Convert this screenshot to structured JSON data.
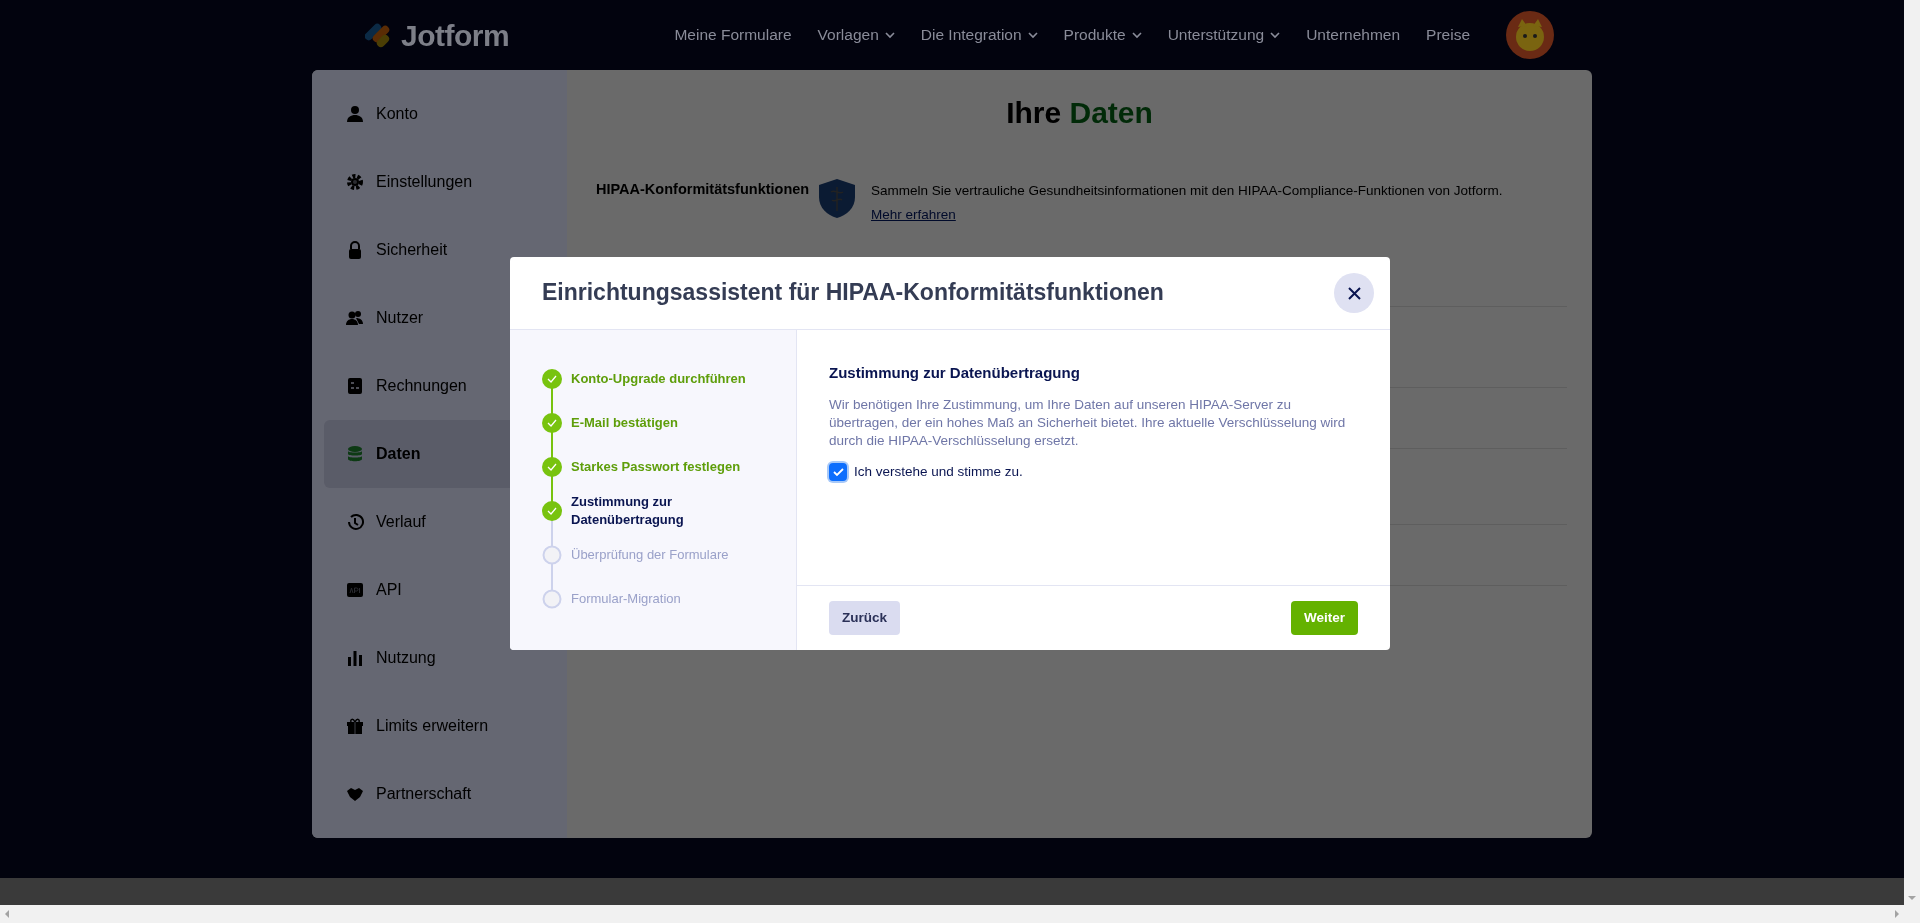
{
  "nav": {
    "logo": "Jotform",
    "items": [
      {
        "label": "Meine Formulare",
        "has_dropdown": false
      },
      {
        "label": "Vorlagen",
        "has_dropdown": true
      },
      {
        "label": "Die Integration",
        "has_dropdown": true
      },
      {
        "label": "Produkte",
        "has_dropdown": true
      },
      {
        "label": "Unterstützung",
        "has_dropdown": true
      },
      {
        "label": "Unternehmen",
        "has_dropdown": false
      },
      {
        "label": "Preise",
        "has_dropdown": false
      }
    ]
  },
  "sidebar": {
    "items": [
      {
        "label": "Konto",
        "selected": false
      },
      {
        "label": "Einstellungen",
        "selected": false
      },
      {
        "label": "Sicherheit",
        "selected": false
      },
      {
        "label": "Nutzer",
        "selected": false
      },
      {
        "label": "Rechnungen",
        "selected": false
      },
      {
        "label": "Daten",
        "selected": true
      },
      {
        "label": "Verlauf",
        "selected": false
      },
      {
        "label": "API",
        "selected": false
      },
      {
        "label": "Nutzung",
        "selected": false
      },
      {
        "label": "Limits erweitern",
        "selected": false
      },
      {
        "label": "Partnerschaft",
        "selected": false
      }
    ]
  },
  "page": {
    "title": "Ihre",
    "title_highlight": "Daten",
    "sections": [
      {
        "label": "HIPAA-Konformitätsfunktionen",
        "description": "Sammeln Sie vertrauliche Gesundheitsinformationen mit den HIPAA-Compliance-Funktionen von Jotform.",
        "link": "Mehr erfahren"
      }
    ]
  },
  "modal": {
    "title": "Einrichtungsassistent für HIPAA-Konformitätsfunktionen",
    "steps": [
      {
        "label": "Konto-Upgrade durchführen",
        "kind": "done"
      },
      {
        "label": "E-Mail bestätigen",
        "kind": "done"
      },
      {
        "label": "Starkes Passwort festlegen",
        "kind": "done"
      },
      {
        "label": "Zustimmung zur Datenübertragung",
        "kind": "current"
      },
      {
        "label": "Überprüfung der Formulare",
        "kind": "pending"
      },
      {
        "label": "Formular-Migration",
        "kind": "pending"
      }
    ],
    "step_title": "Zustimmung zur Datenübertragung",
    "text": "Wir benötigen Ihre Zustimmung, um Ihre Daten auf unseren HIPAA-Server zu übertragen, der ein hohes Maß an Sicherheit bietet. Ihre aktuelle Verschlüsselung wird durch die HIPAA-Verschlüsselung ersetzt.",
    "consent": {
      "label": "Ich verstehe und stimme zu.",
      "checked": true
    },
    "buttons": {
      "back": "Zurück",
      "next": "Weiter"
    }
  }
}
